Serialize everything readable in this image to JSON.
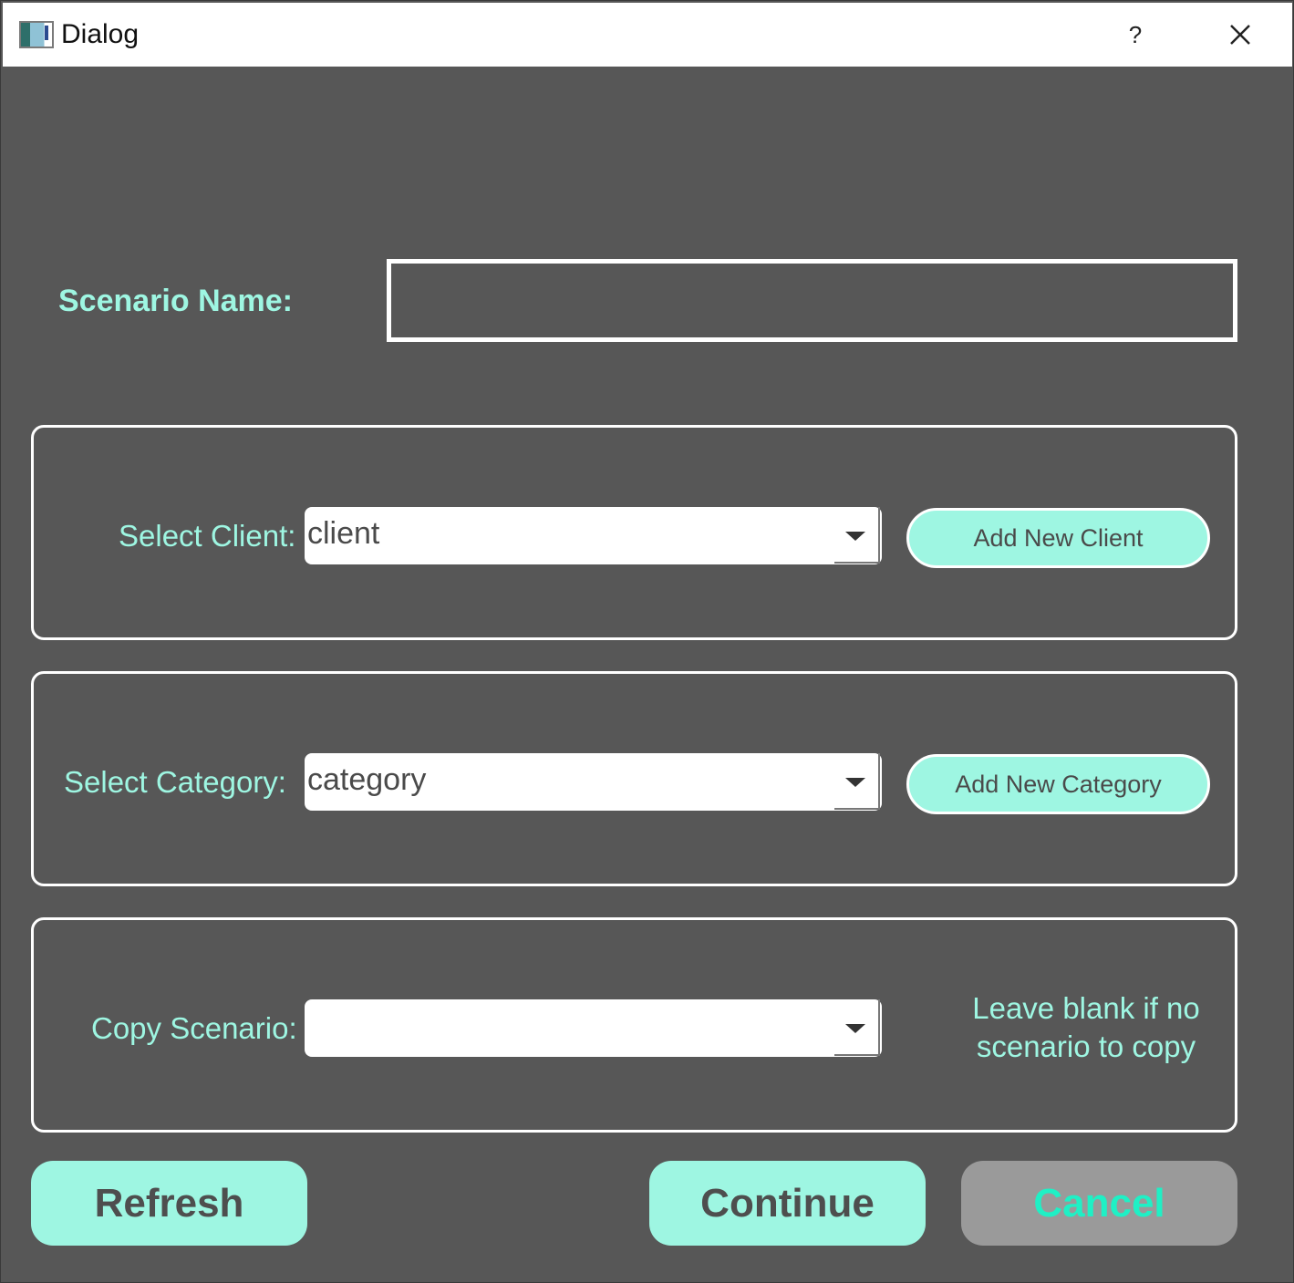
{
  "window": {
    "title": "Dialog",
    "help_label": "?",
    "icons": {
      "app": "app-window-icon",
      "close": "close-x-icon"
    }
  },
  "scenario": {
    "label": "Scenario Name:",
    "value": "",
    "placeholder": ""
  },
  "client": {
    "label": "Select Client:",
    "selected": "client",
    "add_button": "Add New Client"
  },
  "category": {
    "label": "Select Category:",
    "selected": "category",
    "add_button": "Add New Category"
  },
  "copy": {
    "label": "Copy Scenario:",
    "selected": "",
    "hint": "Leave blank if no scenario to copy"
  },
  "buttons": {
    "refresh": "Refresh",
    "continue": "Continue",
    "cancel": "Cancel"
  },
  "colors": {
    "background": "#575757",
    "accent": "#9ef6e2",
    "cancel_bg": "#9a9a9a",
    "cancel_text": "#1ff0c5",
    "border": "#ffffff"
  }
}
